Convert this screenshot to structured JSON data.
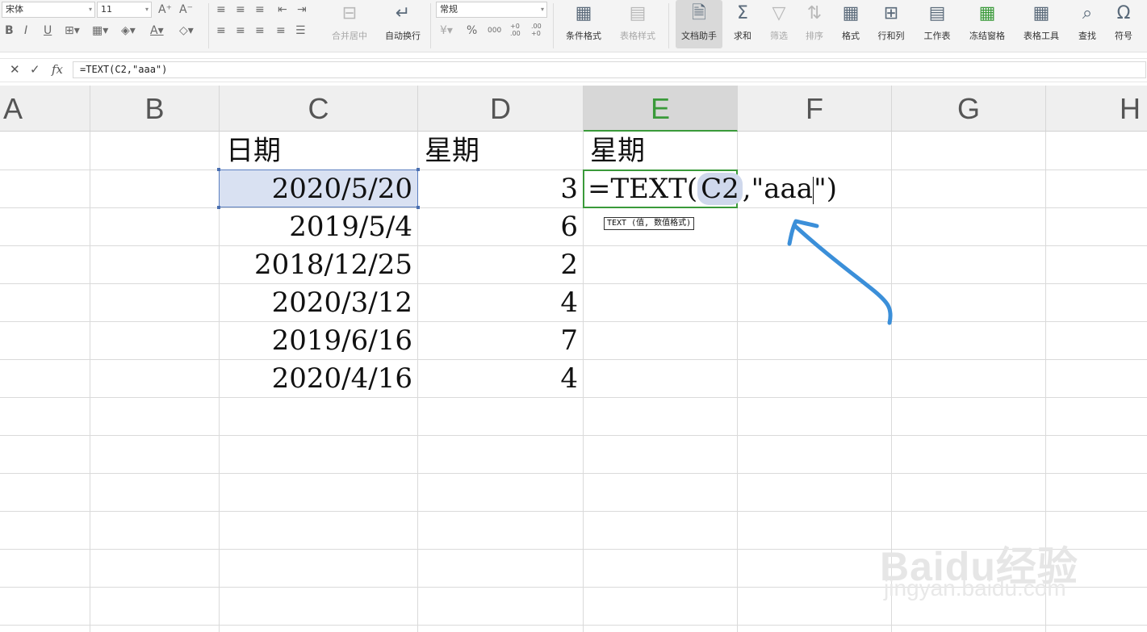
{
  "toolbar": {
    "font_name": "宋体",
    "font_size": "11",
    "number_format": "常规",
    "merge_label": "合并居中",
    "wrap_label": "自动换行",
    "percent_symbol": "%",
    "thousands_symbol": "000",
    "inc_decimal": "+0 .00",
    "dec_decimal": ".00 +0",
    "cond_format": "条件格式",
    "table_style": "表格样式",
    "doc_assistant": "文档助手",
    "sum": "求和",
    "filter": "筛选",
    "sort": "排序",
    "format": "格式",
    "rows_cols": "行和列",
    "worksheet": "工作表",
    "freeze": "冻结窗格",
    "table_tools": "表格工具",
    "find": "查找",
    "symbol": "符号"
  },
  "formula_bar": {
    "fx_label": "fx",
    "formula": "=TEXT(C2,\"aaa\")"
  },
  "columns": [
    "A",
    "B",
    "C",
    "D",
    "E",
    "F",
    "G",
    "H"
  ],
  "header_row": {
    "c": "日期",
    "d": "星期",
    "e": "星期"
  },
  "rows": [
    {
      "date": "2020/5/20",
      "weekday": "3"
    },
    {
      "date": "2019/5/4",
      "weekday": "6"
    },
    {
      "date": "2018/12/25",
      "weekday": "2"
    },
    {
      "date": "2020/3/12",
      "weekday": "4"
    },
    {
      "date": "2019/6/16",
      "weekday": "7"
    },
    {
      "date": "2020/4/16",
      "weekday": "4"
    }
  ],
  "editing_cell": {
    "prefix": "=TEXT(",
    "ref": "C2",
    "mid": ",\"aaa",
    "suffix": "\")"
  },
  "tooltip": "TEXT (值, 数值格式)",
  "annotation_color": "#3b8fd9",
  "watermark": {
    "line1": "Baidu经验",
    "line2": "jingyan.baidu.com"
  }
}
